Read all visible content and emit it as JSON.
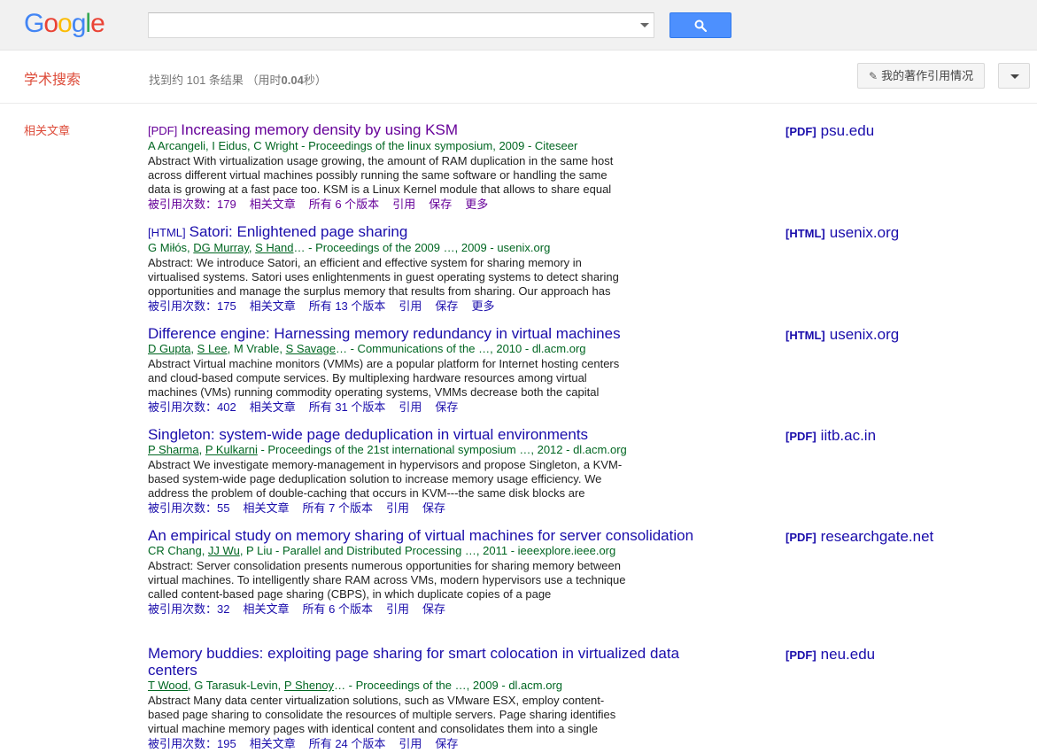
{
  "header": {
    "logo_letters": [
      {
        "ch": "G",
        "color": "#4285f4"
      },
      {
        "ch": "o",
        "color": "#ea4335"
      },
      {
        "ch": "o",
        "color": "#fbbc05"
      },
      {
        "ch": "g",
        "color": "#4285f4"
      },
      {
        "ch": "l",
        "color": "#34a853"
      },
      {
        "ch": "e",
        "color": "#ea4335"
      }
    ],
    "search_value": "",
    "search_icon": "magnifier-icon"
  },
  "subheader": {
    "title": "学术搜索",
    "stats_prefix": "找到约 101 条结果 （用时",
    "stats_time": "0.04",
    "stats_suffix": "秒）",
    "citations_label": "我的著作引用情况",
    "citations_icon": "pencil-icon"
  },
  "sidebar": {
    "related_label": "相关文章"
  },
  "results": [
    {
      "tag": "[PDF]",
      "title": "Increasing memory density by using KSM",
      "visited": true,
      "authors": [
        {
          "text": "A Arcangeli, I Eidus, C Wright",
          "link": false
        }
      ],
      "venue": " - Proceedings of the linux symposium, 2009 - Citeseer",
      "snippet": "Abstract With virtualization usage growing, the amount of RAM duplication in the same host across different virtual machines possibly running the same software or handling the same data is growing at a fast pace too. KSM is a Linux Kernel module that allows to share equal",
      "cited": "被引用次数：179",
      "related": "相关文章",
      "versions": "所有 6 个版本",
      "cite": "引用",
      "save": "保存",
      "more": "更多",
      "side_type": "[PDF]",
      "side_domain": "psu.edu"
    },
    {
      "tag": "[HTML]",
      "title": "Satori: Enlightened page sharing",
      "visited": false,
      "authors": [
        {
          "text": "G Miłós, ",
          "link": false
        },
        {
          "text": "DG Murray",
          "link": true
        },
        {
          "text": ", ",
          "link": false
        },
        {
          "text": "S Hand",
          "link": true
        },
        {
          "text": "…",
          "link": false
        }
      ],
      "venue": " - Proceedings of the 2009 …, 2009 - usenix.org",
      "snippet": "Abstract: We introduce Satori, an efficient and effective system for sharing memory in virtualised systems. Satori uses enlightenments in guest operating systems to detect sharing opportunities and manage the surplus memory that results from sharing. Our approach has",
      "cited": "被引用次数：175",
      "related": "相关文章",
      "versions": "所有 13 个版本",
      "cite": "引用",
      "save": "保存",
      "more": "更多",
      "side_type": "[HTML]",
      "side_domain": "usenix.org"
    },
    {
      "tag": "",
      "title": "Difference engine: Harnessing memory redundancy in virtual machines",
      "visited": false,
      "authors": [
        {
          "text": "D Gupta",
          "link": true
        },
        {
          "text": ", ",
          "link": false
        },
        {
          "text": "S Lee",
          "link": true
        },
        {
          "text": ", M Vrable, ",
          "link": false
        },
        {
          "text": "S Savage",
          "link": true
        },
        {
          "text": "…",
          "link": false
        }
      ],
      "venue": " - Communications of the …, 2010 - dl.acm.org",
      "snippet": "Abstract Virtual machine monitors (VMMs) are a popular platform for Internet hosting centers and cloud-based compute services. By multiplexing hardware resources among virtual machines (VMs) running commodity operating systems, VMMs decrease both the capital",
      "cited": "被引用次数：402",
      "related": "相关文章",
      "versions": "所有 31 个版本",
      "cite": "引用",
      "save": "保存",
      "more": "",
      "side_type": "[HTML]",
      "side_domain": "usenix.org"
    },
    {
      "tag": "",
      "title": "Singleton: system-wide page deduplication in virtual environments",
      "visited": false,
      "authors": [
        {
          "text": "P Sharma",
          "link": true
        },
        {
          "text": ", ",
          "link": false
        },
        {
          "text": "P Kulkarni",
          "link": true
        }
      ],
      "venue": " - Proceedings of the 21st international symposium …, 2012 - dl.acm.org",
      "snippet": "Abstract We investigate memory-management in hypervisors and propose Singleton, a KVM-based system-wide page deduplication solution to increase memory usage efficiency. We address the problem of double-caching that occurs in KVM---the same disk blocks are",
      "cited": "被引用次数：55",
      "related": "相关文章",
      "versions": "所有 7 个版本",
      "cite": "引用",
      "save": "保存",
      "more": "",
      "side_type": "[PDF]",
      "side_domain": "iitb.ac.in"
    },
    {
      "tag": "",
      "title": "An empirical study on memory sharing of virtual machines for server consolidation",
      "visited": false,
      "authors": [
        {
          "text": "CR Chang, ",
          "link": false
        },
        {
          "text": "JJ Wu",
          "link": true
        },
        {
          "text": ", P Liu",
          "link": false
        }
      ],
      "venue": " - Parallel and Distributed Processing …, 2011 - ieeexplore.ieee.org",
      "snippet": "Abstract: Server consolidation presents numerous opportunities for sharing memory between virtual machines. To intelligently share RAM across VMs, modern hypervisors use a technique called content-based page sharing (CBPS), in which duplicate copies of a page",
      "cited": "被引用次数：32",
      "related": "相关文章",
      "versions": "所有 6 个版本",
      "cite": "引用",
      "save": "保存",
      "more": "",
      "side_type": "[PDF]",
      "side_domain": "researchgate.net"
    },
    {
      "tag": "",
      "title": "Memory buddies: exploiting page sharing for smart colocation in virtualized data centers",
      "visited": false,
      "authors": [
        {
          "text": "T Wood",
          "link": true
        },
        {
          "text": ", G Tarasuk-Levin, ",
          "link": false
        },
        {
          "text": "P Shenoy",
          "link": true
        },
        {
          "text": "…",
          "link": false
        }
      ],
      "venue": " - Proceedings of the …, 2009 - dl.acm.org",
      "snippet": "Abstract Many data center virtualization solutions, such as VMware ESX, employ content-based page sharing to consolidate the resources of multiple servers. Page sharing identifies virtual machine memory pages with identical content and consolidates them into a single",
      "cited": "被引用次数：195",
      "related": "相关文章",
      "versions": "所有 24 个版本",
      "cite": "引用",
      "save": "保存",
      "more": "",
      "side_type": "[PDF]",
      "side_domain": "neu.edu"
    }
  ]
}
